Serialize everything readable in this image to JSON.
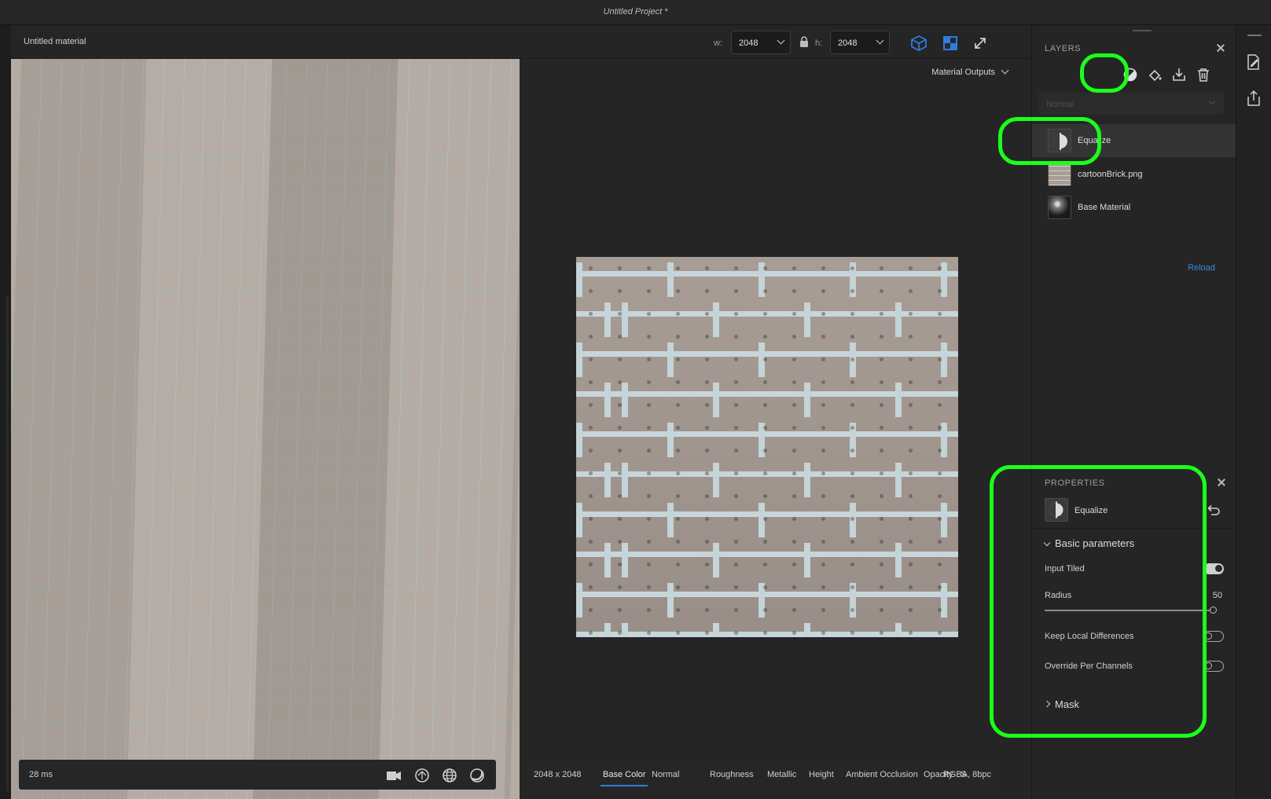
{
  "window": {
    "project_title": "Untitled Project *"
  },
  "toolbar": {
    "material_name": "Untitled material",
    "width_label": "w:",
    "width_value": "2048",
    "height_label": "h:",
    "height_value": "2048",
    "icons": [
      "cube-view-icon",
      "split-view-icon",
      "expand-icon"
    ],
    "active_color": "#2f7ddb"
  },
  "viewport3d": {
    "render_time": "28 ms",
    "tool_icons": [
      "camera-icon",
      "environment-icon",
      "globe-icon",
      "sphere-icon"
    ]
  },
  "viewport2d": {
    "outputs_label": "Material Outputs",
    "resolution": "2048 x 2048",
    "channels": [
      "Base Color",
      "Normal",
      "Roughness",
      "Metallic",
      "Height",
      "Ambient Occlusion",
      "Opacity",
      "S"
    ],
    "active_channel": "Base Color",
    "format": "RGBA, 8bpc"
  },
  "layers": {
    "title": "LAYERS",
    "blend_mode": "Normal",
    "items": [
      {
        "name": "Equalize",
        "selected": true
      },
      {
        "name": "cartoonBrick.png",
        "selected": false
      },
      {
        "name": "Base Material",
        "selected": false
      }
    ],
    "reload_label": "Reload",
    "link_color": "#3b86e0"
  },
  "properties": {
    "title": "PROPERTIES",
    "filter_name": "Equalize",
    "basic_section": "Basic parameters",
    "input_tiled_label": "Input Tiled",
    "input_tiled": true,
    "radius_label": "Radius",
    "radius_value": "50",
    "radius_fraction": 1.0,
    "keep_local_label": "Keep Local Differences",
    "keep_local": false,
    "override_label": "Override Per Channels",
    "override": false,
    "mask_section": "Mask"
  },
  "highlight_color": "#1bff1b"
}
